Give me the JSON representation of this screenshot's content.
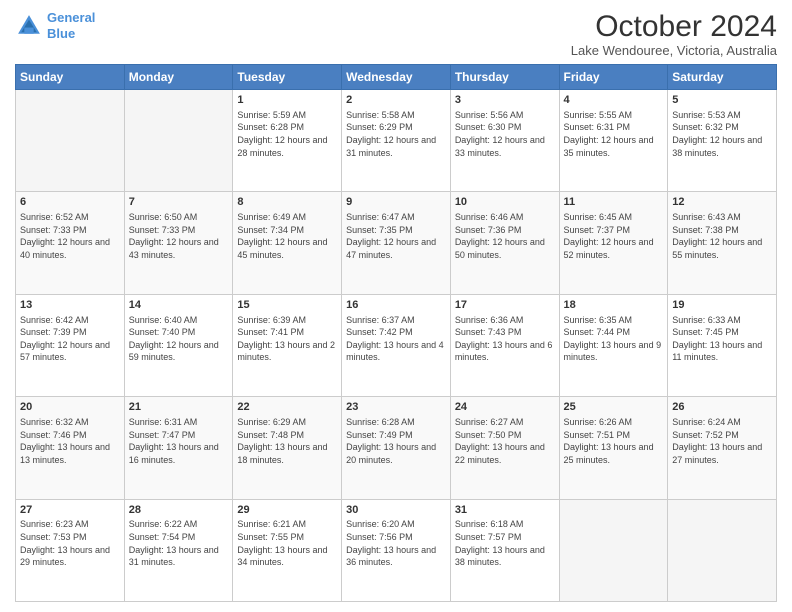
{
  "header": {
    "logo_line1": "General",
    "logo_line2": "Blue",
    "title": "October 2024",
    "subtitle": "Lake Wendouree, Victoria, Australia"
  },
  "weekdays": [
    "Sunday",
    "Monday",
    "Tuesday",
    "Wednesday",
    "Thursday",
    "Friday",
    "Saturday"
  ],
  "weeks": [
    [
      {
        "day": "",
        "sunrise": "",
        "sunset": "",
        "daylight": ""
      },
      {
        "day": "",
        "sunrise": "",
        "sunset": "",
        "daylight": ""
      },
      {
        "day": "1",
        "sunrise": "Sunrise: 5:59 AM",
        "sunset": "Sunset: 6:28 PM",
        "daylight": "Daylight: 12 hours and 28 minutes."
      },
      {
        "day": "2",
        "sunrise": "Sunrise: 5:58 AM",
        "sunset": "Sunset: 6:29 PM",
        "daylight": "Daylight: 12 hours and 31 minutes."
      },
      {
        "day": "3",
        "sunrise": "Sunrise: 5:56 AM",
        "sunset": "Sunset: 6:30 PM",
        "daylight": "Daylight: 12 hours and 33 minutes."
      },
      {
        "day": "4",
        "sunrise": "Sunrise: 5:55 AM",
        "sunset": "Sunset: 6:31 PM",
        "daylight": "Daylight: 12 hours and 35 minutes."
      },
      {
        "day": "5",
        "sunrise": "Sunrise: 5:53 AM",
        "sunset": "Sunset: 6:32 PM",
        "daylight": "Daylight: 12 hours and 38 minutes."
      }
    ],
    [
      {
        "day": "6",
        "sunrise": "Sunrise: 6:52 AM",
        "sunset": "Sunset: 7:33 PM",
        "daylight": "Daylight: 12 hours and 40 minutes."
      },
      {
        "day": "7",
        "sunrise": "Sunrise: 6:50 AM",
        "sunset": "Sunset: 7:33 PM",
        "daylight": "Daylight: 12 hours and 43 minutes."
      },
      {
        "day": "8",
        "sunrise": "Sunrise: 6:49 AM",
        "sunset": "Sunset: 7:34 PM",
        "daylight": "Daylight: 12 hours and 45 minutes."
      },
      {
        "day": "9",
        "sunrise": "Sunrise: 6:47 AM",
        "sunset": "Sunset: 7:35 PM",
        "daylight": "Daylight: 12 hours and 47 minutes."
      },
      {
        "day": "10",
        "sunrise": "Sunrise: 6:46 AM",
        "sunset": "Sunset: 7:36 PM",
        "daylight": "Daylight: 12 hours and 50 minutes."
      },
      {
        "day": "11",
        "sunrise": "Sunrise: 6:45 AM",
        "sunset": "Sunset: 7:37 PM",
        "daylight": "Daylight: 12 hours and 52 minutes."
      },
      {
        "day": "12",
        "sunrise": "Sunrise: 6:43 AM",
        "sunset": "Sunset: 7:38 PM",
        "daylight": "Daylight: 12 hours and 55 minutes."
      }
    ],
    [
      {
        "day": "13",
        "sunrise": "Sunrise: 6:42 AM",
        "sunset": "Sunset: 7:39 PM",
        "daylight": "Daylight: 12 hours and 57 minutes."
      },
      {
        "day": "14",
        "sunrise": "Sunrise: 6:40 AM",
        "sunset": "Sunset: 7:40 PM",
        "daylight": "Daylight: 12 hours and 59 minutes."
      },
      {
        "day": "15",
        "sunrise": "Sunrise: 6:39 AM",
        "sunset": "Sunset: 7:41 PM",
        "daylight": "Daylight: 13 hours and 2 minutes."
      },
      {
        "day": "16",
        "sunrise": "Sunrise: 6:37 AM",
        "sunset": "Sunset: 7:42 PM",
        "daylight": "Daylight: 13 hours and 4 minutes."
      },
      {
        "day": "17",
        "sunrise": "Sunrise: 6:36 AM",
        "sunset": "Sunset: 7:43 PM",
        "daylight": "Daylight: 13 hours and 6 minutes."
      },
      {
        "day": "18",
        "sunrise": "Sunrise: 6:35 AM",
        "sunset": "Sunset: 7:44 PM",
        "daylight": "Daylight: 13 hours and 9 minutes."
      },
      {
        "day": "19",
        "sunrise": "Sunrise: 6:33 AM",
        "sunset": "Sunset: 7:45 PM",
        "daylight": "Daylight: 13 hours and 11 minutes."
      }
    ],
    [
      {
        "day": "20",
        "sunrise": "Sunrise: 6:32 AM",
        "sunset": "Sunset: 7:46 PM",
        "daylight": "Daylight: 13 hours and 13 minutes."
      },
      {
        "day": "21",
        "sunrise": "Sunrise: 6:31 AM",
        "sunset": "Sunset: 7:47 PM",
        "daylight": "Daylight: 13 hours and 16 minutes."
      },
      {
        "day": "22",
        "sunrise": "Sunrise: 6:29 AM",
        "sunset": "Sunset: 7:48 PM",
        "daylight": "Daylight: 13 hours and 18 minutes."
      },
      {
        "day": "23",
        "sunrise": "Sunrise: 6:28 AM",
        "sunset": "Sunset: 7:49 PM",
        "daylight": "Daylight: 13 hours and 20 minutes."
      },
      {
        "day": "24",
        "sunrise": "Sunrise: 6:27 AM",
        "sunset": "Sunset: 7:50 PM",
        "daylight": "Daylight: 13 hours and 22 minutes."
      },
      {
        "day": "25",
        "sunrise": "Sunrise: 6:26 AM",
        "sunset": "Sunset: 7:51 PM",
        "daylight": "Daylight: 13 hours and 25 minutes."
      },
      {
        "day": "26",
        "sunrise": "Sunrise: 6:24 AM",
        "sunset": "Sunset: 7:52 PM",
        "daylight": "Daylight: 13 hours and 27 minutes."
      }
    ],
    [
      {
        "day": "27",
        "sunrise": "Sunrise: 6:23 AM",
        "sunset": "Sunset: 7:53 PM",
        "daylight": "Daylight: 13 hours and 29 minutes."
      },
      {
        "day": "28",
        "sunrise": "Sunrise: 6:22 AM",
        "sunset": "Sunset: 7:54 PM",
        "daylight": "Daylight: 13 hours and 31 minutes."
      },
      {
        "day": "29",
        "sunrise": "Sunrise: 6:21 AM",
        "sunset": "Sunset: 7:55 PM",
        "daylight": "Daylight: 13 hours and 34 minutes."
      },
      {
        "day": "30",
        "sunrise": "Sunrise: 6:20 AM",
        "sunset": "Sunset: 7:56 PM",
        "daylight": "Daylight: 13 hours and 36 minutes."
      },
      {
        "day": "31",
        "sunrise": "Sunrise: 6:18 AM",
        "sunset": "Sunset: 7:57 PM",
        "daylight": "Daylight: 13 hours and 38 minutes."
      },
      {
        "day": "",
        "sunrise": "",
        "sunset": "",
        "daylight": ""
      },
      {
        "day": "",
        "sunrise": "",
        "sunset": "",
        "daylight": ""
      }
    ]
  ]
}
